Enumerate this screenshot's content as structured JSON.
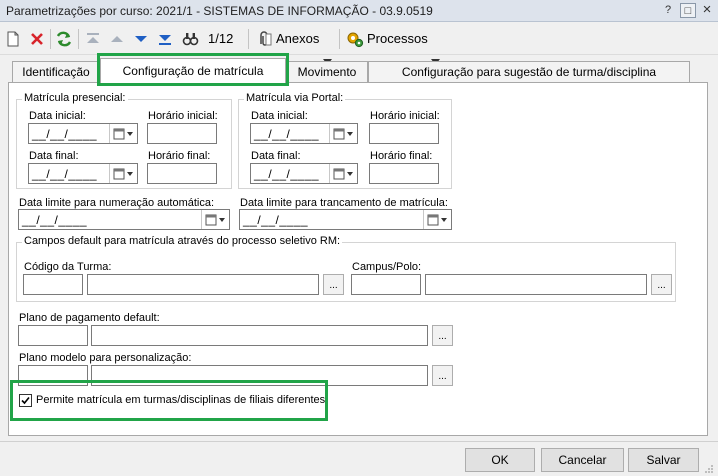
{
  "window": {
    "title": "Parametrizações por curso: 2021/1 - SISTEMAS DE INFORMAÇÃO - 03.9.0519",
    "help_label": "?",
    "close_label": "×"
  },
  "toolbar": {
    "record_counter": "1/12",
    "anexos_label": "Anexos",
    "processos_label": "Processos"
  },
  "tabs": [
    {
      "label": "Identificação"
    },
    {
      "label": "Configuração de matrícula"
    },
    {
      "label": "Movimento"
    },
    {
      "label": "Configuração para sugestão de turma/disciplina"
    }
  ],
  "form": {
    "presencial": {
      "title": "Matrícula presencial:",
      "data_inicial_label": "Data inicial:",
      "horario_inicial_label": "Horário inicial:",
      "data_final_label": "Data final:",
      "horario_final_label": "Horário final:",
      "data_inicial_value": "__/__/____",
      "data_final_value": "__/__/____"
    },
    "portal": {
      "title": "Matrícula via Portal:",
      "data_inicial_label": "Data inicial:",
      "horario_inicial_label": "Horário inicial:",
      "data_final_label": "Data final:",
      "horario_final_label": "Horário final:",
      "data_inicial_value": "__/__/____",
      "data_final_value": "__/__/____"
    },
    "data_limite_numeracao_label": "Data limite para numeração automática:",
    "data_limite_numeracao_value": "__/__/____",
    "data_limite_trancamento_label": "Data limite para trancamento de matrícula:",
    "data_limite_trancamento_value": "__/__/____",
    "campos_default": {
      "title": "Campos default para matrícula através do processo seletivo RM:",
      "codigo_turma_label": "Código da Turma:",
      "campus_polo_label": "Campus/Polo:"
    },
    "plano_pagamento_label": "Plano de pagamento default:",
    "plano_modelo_label": "Plano modelo para personalização:",
    "ellipsis_label": "...",
    "filiais_checkbox_label": "Permite matrícula em turmas/disciplinas de filiais diferentes",
    "filiais_checked": true
  },
  "footer": {
    "ok_label": "OK",
    "cancel_label": "Cancelar",
    "save_label": "Salvar"
  },
  "colors": {
    "highlight": "#21a448",
    "title_bar": "#dde3ec"
  }
}
